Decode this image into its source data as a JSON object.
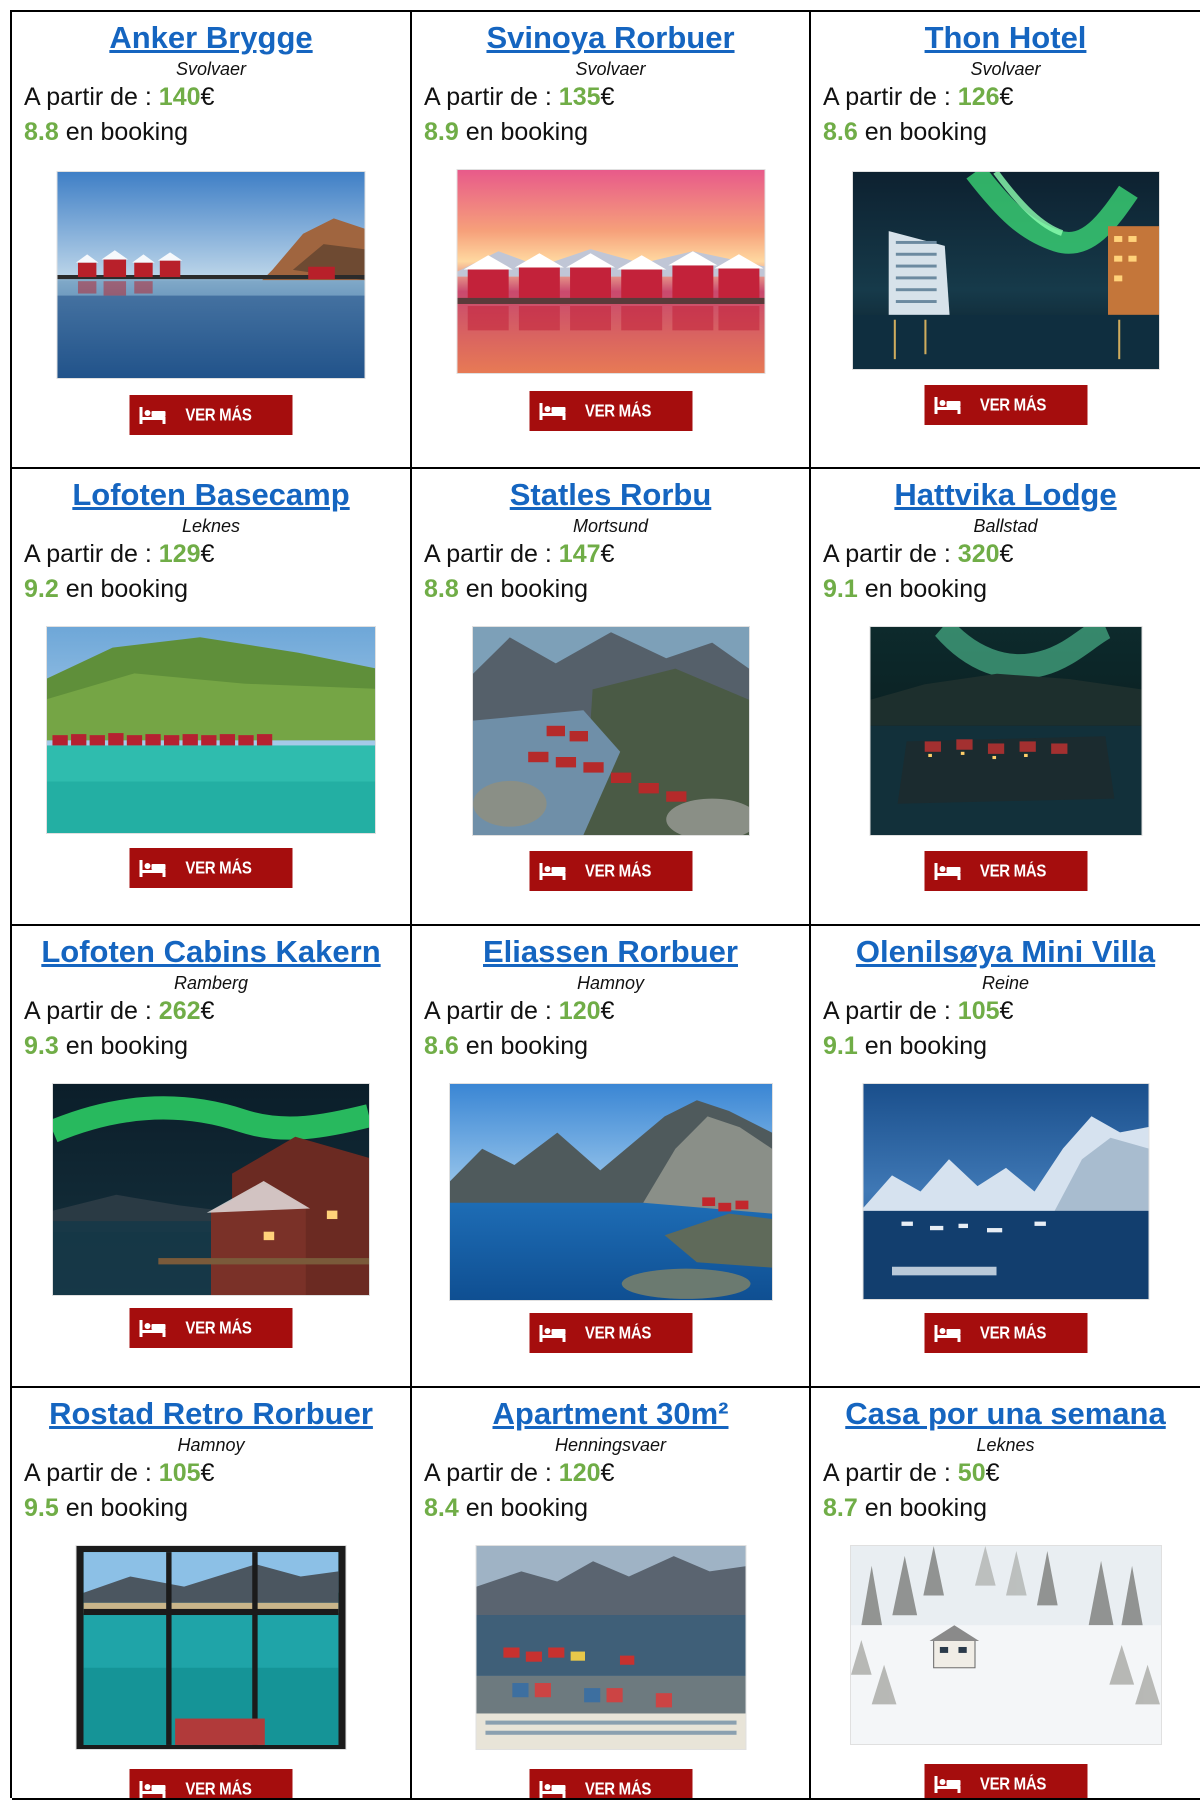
{
  "labels": {
    "price_prefix": "A partir de : ",
    "currency": "€",
    "rating_suffix": " en booking"
  },
  "accent_colors": {
    "link": "#1565c0",
    "highlight": "#70ad47",
    "button": "#a50d0d"
  },
  "listings": [
    {
      "name": "Anker Brygge",
      "location": "Svolvaer",
      "price": "140",
      "rating": "8.8",
      "button_label": "VER MÁS",
      "button_icon": "bed-icon",
      "image": "harbor-red-cabins-dusk"
    },
    {
      "name": "Svinoya Rorbuer",
      "location": "Svolvaer",
      "price": "135",
      "rating": "8.9",
      "button_label": "VER MÁS",
      "button_icon": "bed-icon",
      "image": "red-cabins-pink-sunset"
    },
    {
      "name": "Thon Hotel",
      "location": "Svolvaer",
      "price": "126",
      "rating": "8.6",
      "button_label": "VER MÁS",
      "button_icon": "bed-icon",
      "image": "hotel-northern-lights"
    },
    {
      "name": "Lofoten Basecamp",
      "location": "Leknes",
      "price": "129",
      "rating": "9.2",
      "button_label": "VER MÁS",
      "button_icon": "bed-icon",
      "image": "green-hill-turquoise-water"
    },
    {
      "name": "Statles Rorbu",
      "location": "Mortsund",
      "price": "147",
      "rating": "8.8",
      "button_label": "VER MÁS",
      "button_icon": "bed-icon",
      "image": "aerial-red-cabins-rocks"
    },
    {
      "name": "Hattvika Lodge",
      "location": "Ballstad",
      "price": "320",
      "rating": "9.1",
      "button_label": "VER MÁS",
      "button_icon": "bed-icon",
      "image": "lodge-aurora-night"
    },
    {
      "name": "Lofoten Cabins Kakern",
      "location": "Ramberg",
      "price": "262",
      "rating": "9.3",
      "button_label": "VER MÁS",
      "button_icon": "bed-icon",
      "image": "cabins-green-aurora"
    },
    {
      "name": "Eliassen Rorbuer",
      "location": "Hamnoy",
      "price": "120",
      "rating": "8.6",
      "button_label": "VER MÁS",
      "button_icon": "bed-icon",
      "image": "blue-fjord-peaks"
    },
    {
      "name": "Olenilsøya Mini Villa",
      "location": "Reine",
      "price": "105",
      "rating": "9.1",
      "button_label": "VER MÁS",
      "button_icon": "bed-icon",
      "image": "snowy-mountains-harbor"
    },
    {
      "name": "Rostad Retro Rorbuer",
      "location": "Hamnoy",
      "price": "105",
      "rating": "9.5",
      "button_label": "VER MÁS",
      "button_icon": "bed-icon",
      "image": "window-view-turquoise-water"
    },
    {
      "name": "Apartment 30m²",
      "location": "Henningsvaer",
      "price": "120",
      "rating": "8.4",
      "button_label": "VER MÁS",
      "button_icon": "bed-icon",
      "image": "aerial-village-fjord"
    },
    {
      "name": "Casa por una semana",
      "location": "Leknes",
      "price": "50",
      "rating": "8.7",
      "button_label": "VER MÁS",
      "button_icon": "bed-icon",
      "image": "snowy-house-forest"
    }
  ]
}
